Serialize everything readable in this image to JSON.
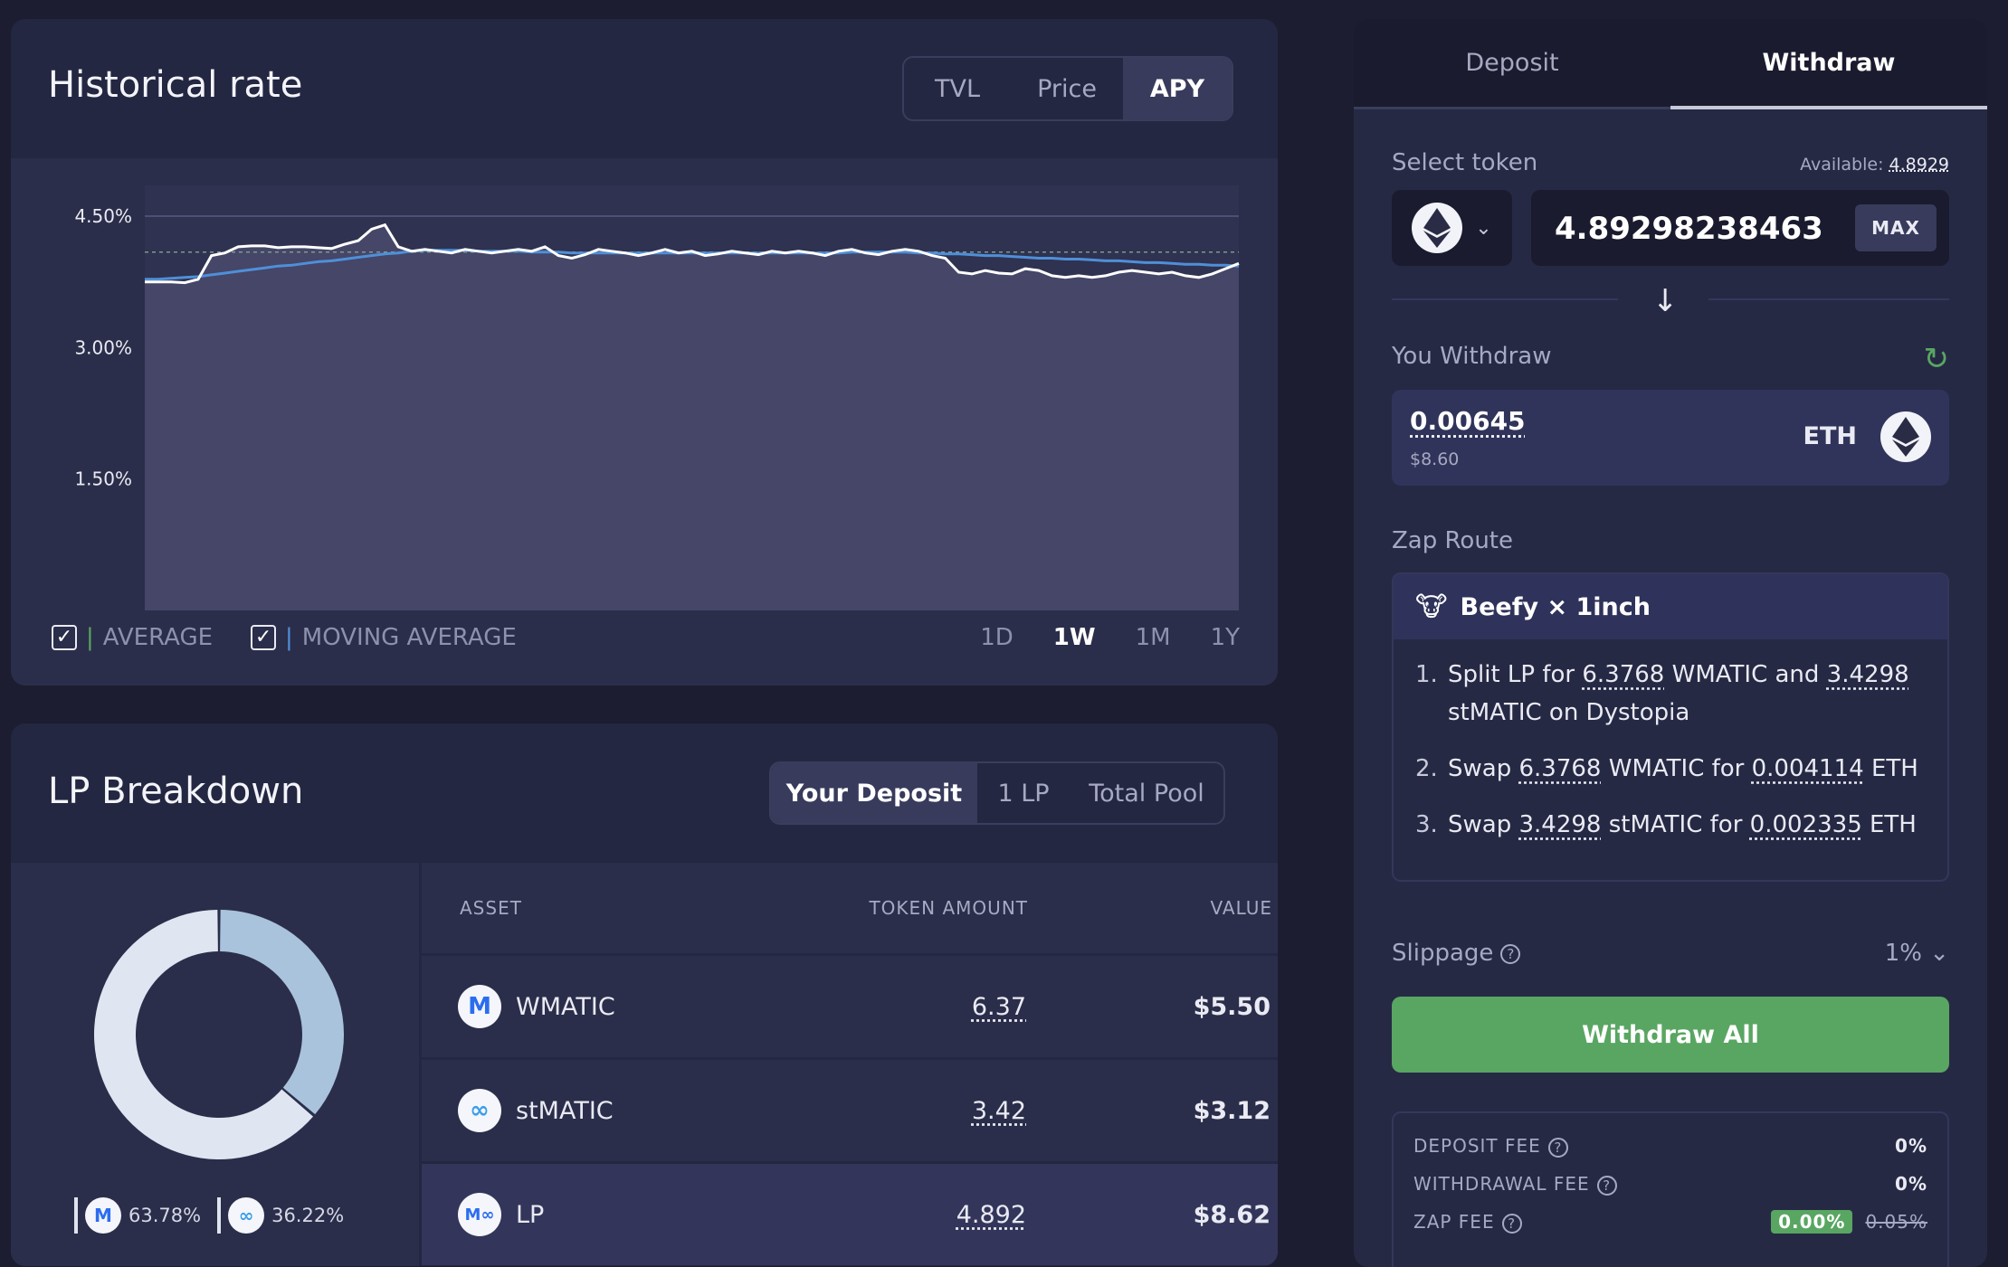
{
  "rate_card": {
    "title": "Historical rate",
    "tabs": [
      "TVL",
      "Price",
      "APY"
    ],
    "active_tab": "APY",
    "legend": {
      "average": "AVERAGE",
      "moving_average": "MOVING AVERAGE",
      "bar": "|"
    },
    "ranges": [
      "1D",
      "1W",
      "1M",
      "1Y"
    ],
    "active_range": "1W"
  },
  "chart_data": {
    "type": "area",
    "title": "Historical rate",
    "ylabel": "",
    "xlabel": "",
    "yticks": [
      "4.50%",
      "3.00%",
      "1.50%"
    ],
    "ytick_values": [
      4.5,
      3.0,
      1.5
    ],
    "ylim": [
      0,
      4.5
    ],
    "grid": true,
    "series": [
      {
        "name": "APY",
        "values": [
          3.75,
          3.75,
          3.75,
          3.74,
          3.78,
          4.05,
          4.08,
          4.15,
          4.16,
          4.16,
          4.14,
          4.15,
          4.15,
          4.14,
          4.13,
          4.18,
          4.22,
          4.35,
          4.4,
          4.15,
          4.1,
          4.12,
          4.1,
          4.08,
          4.12,
          4.1,
          4.08,
          4.1,
          4.12,
          4.1,
          4.15,
          4.05,
          4.02,
          4.06,
          4.12,
          4.1,
          4.08,
          4.05,
          4.08,
          4.12,
          4.08,
          4.1,
          4.05,
          4.07,
          4.1,
          4.08,
          4.06,
          4.1,
          4.08,
          4.1,
          4.08,
          4.05,
          4.1,
          4.12,
          4.08,
          4.06,
          4.1,
          4.12,
          4.1,
          4.05,
          4.02,
          3.86,
          3.84,
          3.88,
          3.85,
          3.84,
          3.9,
          3.88,
          3.82,
          3.8,
          3.82,
          3.8,
          3.82,
          3.86,
          3.88,
          3.86,
          3.84,
          3.86,
          3.82,
          3.8,
          3.84,
          3.9,
          3.96
        ]
      },
      {
        "name": "MOVING AVERAGE",
        "values": [
          3.78,
          3.78,
          3.79,
          3.8,
          3.81,
          3.83,
          3.85,
          3.87,
          3.89,
          3.91,
          3.93,
          3.94,
          3.96,
          3.98,
          3.99,
          4.01,
          4.03,
          4.05,
          4.07,
          4.08,
          4.1,
          4.11,
          4.11,
          4.11,
          4.11,
          4.1,
          4.1,
          4.1,
          4.1,
          4.09,
          4.09,
          4.09,
          4.08,
          4.08,
          4.08,
          4.08,
          4.08,
          4.08,
          4.08,
          4.08,
          4.08,
          4.08,
          4.08,
          4.08,
          4.08,
          4.08,
          4.08,
          4.08,
          4.08,
          4.08,
          4.08,
          4.08,
          4.08,
          4.09,
          4.09,
          4.09,
          4.09,
          4.09,
          4.08,
          4.08,
          4.07,
          4.07,
          4.06,
          4.05,
          4.05,
          4.04,
          4.03,
          4.02,
          4.02,
          4.01,
          4.01,
          4.0,
          3.99,
          3.99,
          3.98,
          3.97,
          3.97,
          3.96,
          3.95,
          3.95,
          3.94,
          3.94,
          3.93
        ]
      }
    ],
    "average": 4.09
  },
  "lp_card": {
    "title": "LP Breakdown",
    "tabs": [
      "Your Deposit",
      "1 LP",
      "Total Pool"
    ],
    "active_tab": "Your Deposit",
    "columns": {
      "asset": "ASSET",
      "amount": "TOKEN AMOUNT",
      "value": "VALUE"
    },
    "rows": [
      {
        "asset": "WMATIC",
        "amount": "6.37",
        "value": "$5.50",
        "icon": "polygon-icon"
      },
      {
        "asset": "stMATIC",
        "amount": "3.42",
        "value": "$3.12",
        "icon": "stmatic-icon"
      },
      {
        "asset": "LP",
        "amount": "4.892",
        "value": "$8.62",
        "icon": "lp-pair-icon"
      }
    ],
    "donut": {
      "slices": [
        {
          "name": "WMATIC",
          "value": 63.78,
          "label": "63.78%",
          "color": "#dfe6f1"
        },
        {
          "name": "stMATIC",
          "value": 36.22,
          "label": "36.22%",
          "color": "#a9c3dc"
        }
      ]
    }
  },
  "side": {
    "tabs": [
      "Deposit",
      "Withdraw"
    ],
    "active_tab": "Withdraw",
    "select_token_label": "Select token",
    "available_label": "Available:",
    "available_value": "4.8929",
    "amount_value": "4.8929823846312",
    "max_label": "MAX",
    "you_withdraw_label": "You Withdraw",
    "withdraw_amount": "0.00645",
    "withdraw_usd": "$8.60",
    "withdraw_symbol": "ETH",
    "zap_route_label": "Zap Route",
    "zap_provider": "Beefy × 1inch",
    "zap_steps": [
      {
        "n": "1.",
        "parts": [
          "Split LP for ",
          "6.3768",
          " WMATIC and ",
          "3.4298",
          " stMATIC on Dystopia"
        ]
      },
      {
        "n": "2.",
        "parts": [
          "Swap ",
          "6.3768",
          " WMATIC for ",
          "0.004114",
          " ETH"
        ]
      },
      {
        "n": "3.",
        "parts": [
          "Swap ",
          "3.4298",
          " stMATIC for ",
          "0.002335",
          " ETH"
        ]
      }
    ],
    "slippage_label": "Slippage",
    "slippage_value": "1%",
    "withdraw_all_label": "Withdraw All",
    "fees": {
      "deposit_label": "DEPOSIT FEE",
      "deposit_value": "0%",
      "withdrawal_label": "WITHDRAWAL FEE",
      "withdrawal_value": "0%",
      "zap_label": "ZAP FEE",
      "zap_value": "0.00%",
      "zap_old_value": "0.05%"
    }
  },
  "colors": {
    "accent_green": "#59a662",
    "moving_average_line": "#4f8fd8",
    "apy_line": "#ffffff",
    "panel": "#242741"
  }
}
